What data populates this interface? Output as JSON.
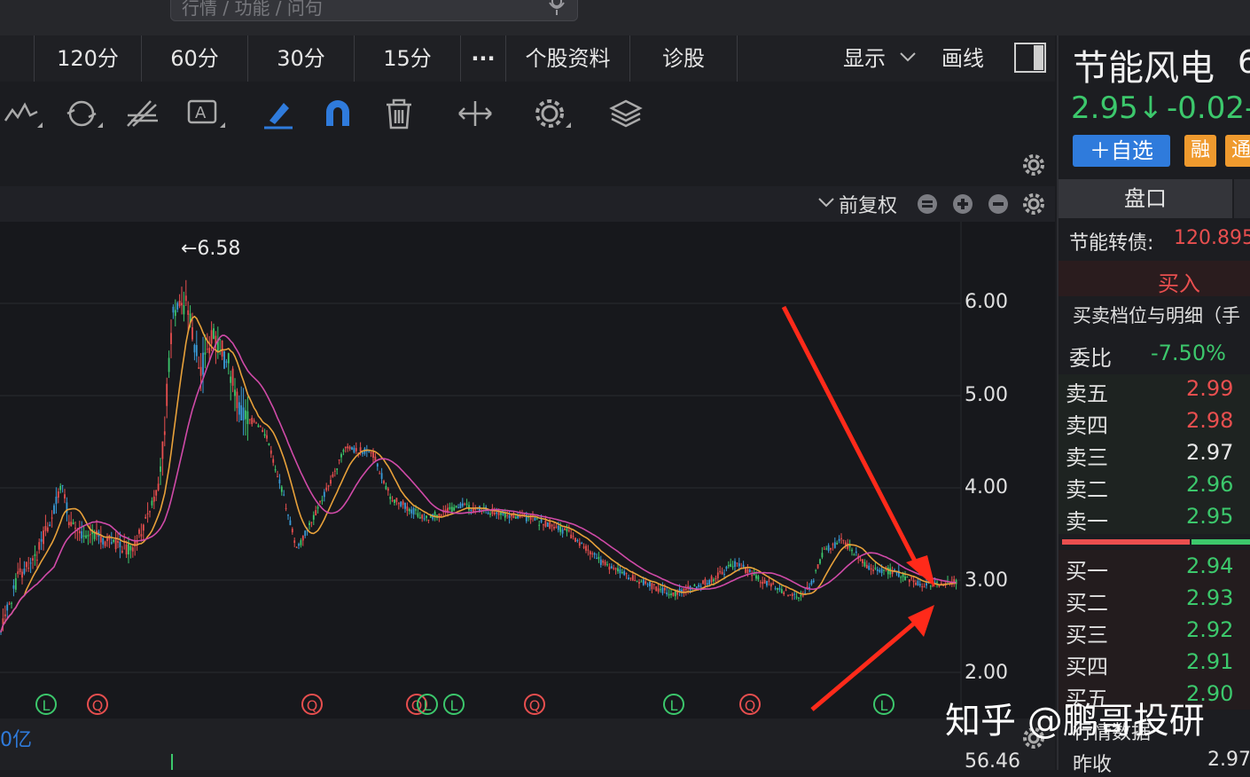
{
  "search": {
    "placeholder": "行情 / 功能 / 问句"
  },
  "tabs": {
    "items": [
      "120分",
      "60分",
      "30分",
      "15分",
      "···",
      "个股资料",
      "诊股"
    ],
    "display_label": "显示",
    "draw_label": "画线"
  },
  "chart": {
    "adjust_label": "前复权",
    "peak_label": "←6.58",
    "price_labels": [
      "6.00",
      "5.00",
      "4.00",
      "3.00",
      "2.00"
    ],
    "markers": [
      "L",
      "Q",
      "Q",
      "Q",
      "L",
      "L",
      "Q",
      "L",
      "Q",
      "L"
    ],
    "bottom_left": "0亿",
    "bottom_right": "56.46"
  },
  "colors": {
    "up": "#e84f4f",
    "down": "#3cc86c",
    "ma_orange": "#e8a13a",
    "ma_pink": "#d04aa8",
    "accent": "#2f7bdc"
  },
  "stock": {
    "name": "节能风电",
    "code_partial": "6",
    "price": "2.95↓",
    "change": "-0.02",
    "change_tail": "-",
    "add_watch": "＋自选",
    "badge_rong": "融",
    "badge_tong": "通"
  },
  "panel": {
    "tab_pankou": "盘口",
    "convertible": "节能转债:",
    "convertible_value": "120.895",
    "buy_label": "买入",
    "detail_title": "买卖档位与明细（手",
    "weibi_label": "委比",
    "weibi_value": "-7.50%",
    "asks": [
      {
        "label": "卖五",
        "price": "2.99"
      },
      {
        "label": "卖四",
        "price": "2.98"
      },
      {
        "label": "卖三",
        "price": "2.97"
      },
      {
        "label": "卖二",
        "price": "2.96"
      },
      {
        "label": "卖一",
        "price": "2.95"
      }
    ],
    "bids": [
      {
        "label": "买一",
        "price": "2.94"
      },
      {
        "label": "买二",
        "price": "2.93"
      },
      {
        "label": "买三",
        "price": "2.92"
      },
      {
        "label": "买四",
        "price": "2.91"
      },
      {
        "label": "买五",
        "price": "2.90"
      }
    ],
    "market_data": "行情数据",
    "prev_close_label": "昨收",
    "prev_close_value": "2.97"
  },
  "watermark": "知乎 @鹏哥投研"
}
